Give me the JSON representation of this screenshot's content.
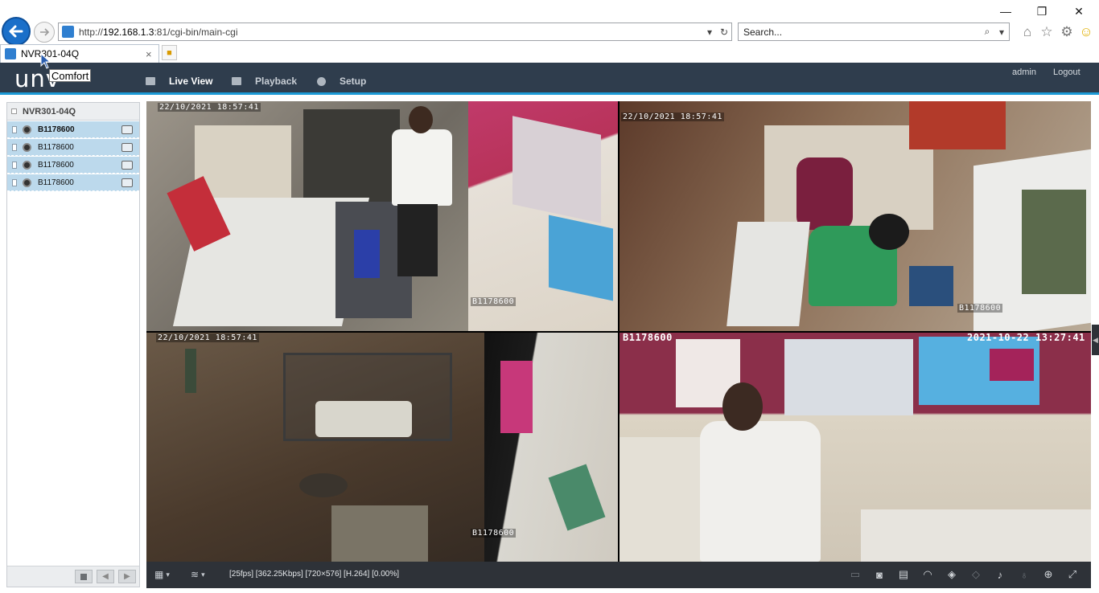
{
  "browser": {
    "url_prefix": "http://",
    "url_host": "192.168.1.3",
    "url_rest": ":81/cgi-bin/main-cgi",
    "search_placeholder": "Search...",
    "tab_title": "NVR301-04Q",
    "tab_close": "×"
  },
  "app": {
    "logo": "unv",
    "tooltip": "Comfort",
    "menu": [
      {
        "label": "Live View",
        "icon": "monitor-icon",
        "active": true
      },
      {
        "label": "Playback",
        "icon": "film-icon",
        "active": false
      },
      {
        "label": "Setup",
        "icon": "gear-icon",
        "active": false
      }
    ],
    "user": "admin",
    "logout": "Logout",
    "accent": "#1c9ad6"
  },
  "device_tree": {
    "device": "NVR301-04Q",
    "cameras": [
      {
        "label": "B1178600",
        "bold": true
      },
      {
        "label": "B1178600",
        "bold": false
      },
      {
        "label": "B1178600",
        "bold": false
      },
      {
        "label": "B1178600",
        "bold": false
      }
    ]
  },
  "tiles": [
    {
      "timestamp": "22/10/2021 18:57:41",
      "name": "B1178600"
    },
    {
      "timestamp": "22/10/2021 18:57:41",
      "name": "B1178600"
    },
    {
      "timestamp": "22/10/2021 18:57:41",
      "name": "B1178600"
    },
    {
      "timestamp": "2021-10-22 13:27:41",
      "name": "B1178600"
    }
  ],
  "status": {
    "stream_info": "[25fps] [362.25Kbps] [720×576] [H.264] [0.00%]"
  }
}
